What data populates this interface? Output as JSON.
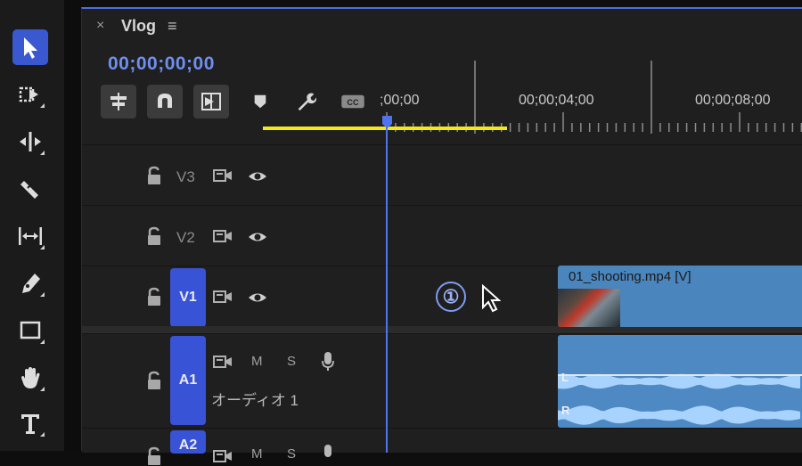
{
  "sequence": {
    "tab_close": "×",
    "name": "Vlog",
    "menu": "≡",
    "timecode": "00;00;00;00"
  },
  "ruler": {
    "labels": [
      ";00;00",
      "00;00;04;00",
      "00;00;08;00"
    ]
  },
  "tools": [
    "selection-tool",
    "track-select-forward-tool",
    "ripple-edit-tool",
    "razor-tool",
    "slip-tool",
    "pen-tool",
    "rectangle-tool",
    "hand-tool",
    "type-tool"
  ],
  "controls": [
    "insert-sequence-as-nest",
    "snap-in-timeline",
    "linked-selection",
    "add-marker",
    "timeline-display-settings",
    "captions"
  ],
  "tracks": {
    "v3": {
      "label": "V3"
    },
    "v2": {
      "label": "V2"
    },
    "v1": {
      "label": "V1"
    },
    "a1": {
      "label": "A1",
      "mute": "M",
      "solo": "S",
      "name": "オーディオ 1"
    },
    "a2": {
      "label": "A2",
      "mute": "M",
      "solo": "S"
    }
  },
  "clips": {
    "video": {
      "name": "01_shooting.mp4 [V]"
    },
    "audio": {
      "left": "L",
      "right": "R"
    }
  },
  "step_marker": "①",
  "colors": {
    "accent": "#4e73ec",
    "clip_video": "#4a85bd",
    "clip_audio": "#4f89c4",
    "work_area": "#f2e81c"
  }
}
